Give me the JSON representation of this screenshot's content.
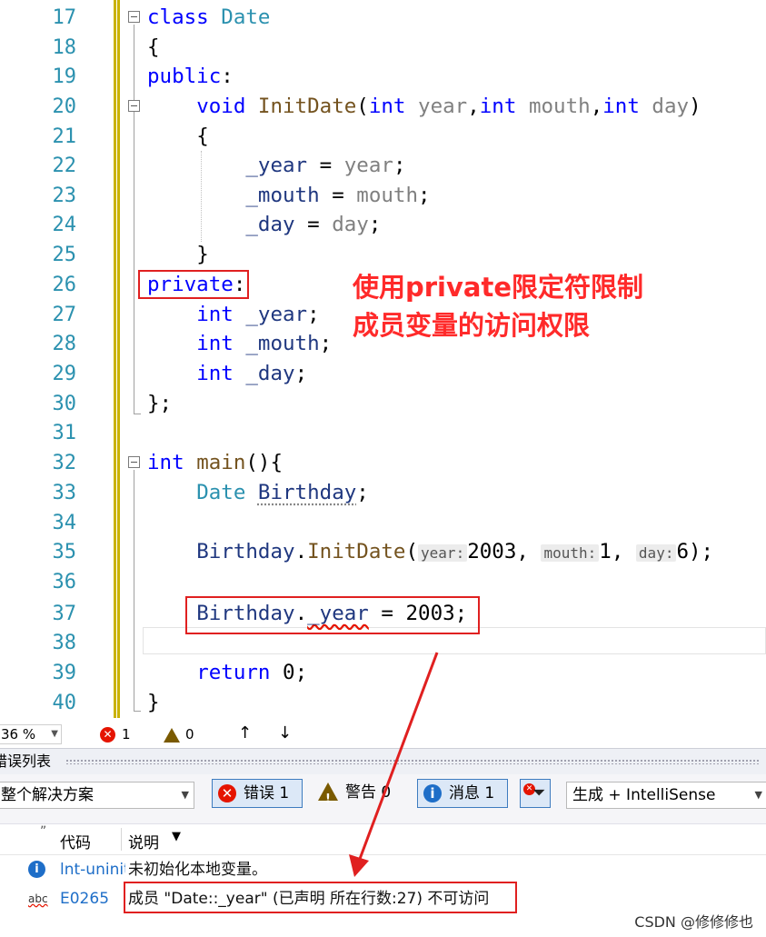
{
  "editor": {
    "lines": [
      {
        "num": "17"
      },
      {
        "num": "18"
      },
      {
        "num": "19"
      },
      {
        "num": "20"
      },
      {
        "num": "21"
      },
      {
        "num": "22"
      },
      {
        "num": "23"
      },
      {
        "num": "24"
      },
      {
        "num": "25"
      },
      {
        "num": "26"
      },
      {
        "num": "27"
      },
      {
        "num": "28"
      },
      {
        "num": "29"
      },
      {
        "num": "30"
      },
      {
        "num": "31"
      },
      {
        "num": "32"
      },
      {
        "num": "33"
      },
      {
        "num": "34"
      },
      {
        "num": "35"
      },
      {
        "num": "36"
      },
      {
        "num": "37"
      },
      {
        "num": "38"
      },
      {
        "num": "39"
      },
      {
        "num": "40"
      }
    ],
    "tokens": {
      "class": "class",
      "Date": "Date",
      "brace_open": "{",
      "brace_close": "}",
      "public": "public",
      "colon": ":",
      "void": "void",
      "InitDate": "InitDate",
      "int": "int",
      "year": "year",
      "mouth": "mouth",
      "day": "day",
      "_year": "_year",
      "_mouth": "_mouth",
      "_day": "_day",
      "private": "private",
      "end": "};",
      "main": "main",
      "Birthday": "Birthday",
      "return": "return",
      "zero": "0",
      "v2003": "2003",
      "v1": "1",
      "v6": "6"
    },
    "hints": {
      "year": "year:",
      "mouth": "mouth:",
      "day": "day:"
    },
    "annotation": [
      "使用private限定符限制",
      "成员变量的访问权限"
    ]
  },
  "status": {
    "zoom": "36 %",
    "errors": "1",
    "warnings": "0"
  },
  "error_list": {
    "title": "错误列表",
    "scope": "整个解决方案",
    "errors_btn": "错误 1",
    "warnings_btn": "警告 0",
    "messages_btn": "消息 1",
    "build_filter": "生成 + IntelliSense",
    "col_code": "代码",
    "col_desc": "说明",
    "rows": [
      {
        "code": "lnt-uninit",
        "desc": "未初始化本地变量。",
        "icon": "info-icon"
      },
      {
        "code": "E0265",
        "desc": "成员 \"Date::_year\" (已声明 所在行数:27) 不可访问",
        "icon": "spell-abc-icon"
      }
    ]
  },
  "watermark": "CSDN @修修修也",
  "colors": {
    "keyword": "#0000ff",
    "type": "#2b91af",
    "function": "#74531f",
    "param": "#808080",
    "annotation": "#ff2a2a",
    "error": "#e51400"
  }
}
